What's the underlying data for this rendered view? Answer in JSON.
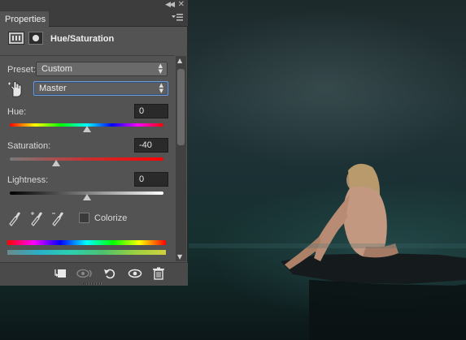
{
  "panel": {
    "tab_label": "Properties",
    "title": "Hue/Saturation",
    "preset_label": "Preset:",
    "preset_value": "Custom",
    "channel_value": "Master",
    "hue": {
      "label": "Hue:",
      "value": "0",
      "level": 0.5
    },
    "saturation": {
      "label": "Saturation:",
      "value": "-40",
      "level": 0.3
    },
    "lightness": {
      "label": "Lightness:",
      "value": "0",
      "level": 0.5
    },
    "colorize_label": "Colorize",
    "colorize_checked": false,
    "icons": {
      "collapse": "double-chevron-left-icon",
      "close": "close-icon",
      "menu": "panel-menu-icon",
      "adjustment": "hue-saturation-adjustment-icon",
      "mask": "layer-mask-icon",
      "targeted_adjustment": "targeted-adjustment-hand-icon",
      "eyedroppers": [
        "eyedropper-icon",
        "eyedropper-plus-icon",
        "eyedropper-minus-icon"
      ],
      "footer": [
        "clip-to-layer-icon",
        "view-previous-state-icon",
        "reset-icon",
        "visibility-eye-icon",
        "trash-icon"
      ]
    }
  },
  "colors": {
    "panel_bg": "#535353",
    "accent_focus": "#6f9ad6",
    "canvas_tint": "#1a3033"
  }
}
